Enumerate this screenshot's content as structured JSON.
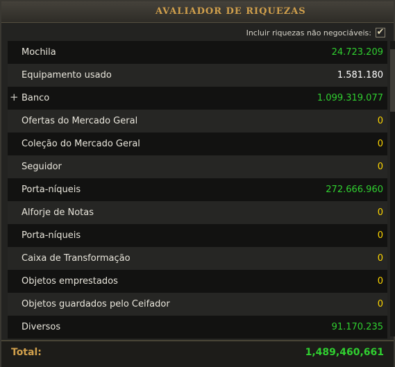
{
  "title": "AVALIADOR DE RIQUEZAS",
  "option": {
    "label": "Incluir riquezas não negociáveis:",
    "checked_glyph": "✔",
    "checked": true
  },
  "colors": {
    "value_green": "#30d030",
    "value_white": "#ffffff",
    "value_zero": "#ffd700",
    "accent": "#d1a04c"
  },
  "rows": [
    {
      "label": "Mochila",
      "value": "24.723.209",
      "tone": "green",
      "expandable": false
    },
    {
      "label": "Equipamento usado",
      "value": "1.581.180",
      "tone": "white",
      "expandable": false
    },
    {
      "label": "Banco",
      "value": "1.099.319.077",
      "tone": "green",
      "expandable": true
    },
    {
      "label": "Ofertas do Mercado Geral",
      "value": "0",
      "tone": "zero",
      "expandable": false
    },
    {
      "label": "Coleção do Mercado Geral",
      "value": "0",
      "tone": "zero",
      "expandable": false
    },
    {
      "label": "Seguidor",
      "value": "0",
      "tone": "zero",
      "expandable": false
    },
    {
      "label": "Porta-níqueis",
      "value": "272.666.960",
      "tone": "green",
      "expandable": false
    },
    {
      "label": "Alforje de Notas",
      "value": "0",
      "tone": "zero",
      "expandable": false
    },
    {
      "label": "Porta-níqueis",
      "value": "0",
      "tone": "zero",
      "expandable": false
    },
    {
      "label": "Caixa de Transformação",
      "value": "0",
      "tone": "zero",
      "expandable": false
    },
    {
      "label": "Objetos emprestados",
      "value": "0",
      "tone": "zero",
      "expandable": false
    },
    {
      "label": "Objetos guardados pelo Ceifador",
      "value": "0",
      "tone": "zero",
      "expandable": false
    },
    {
      "label": "Diversos",
      "value": "91.170.235",
      "tone": "green",
      "expandable": false
    }
  ],
  "expand_glyph": "+",
  "total": {
    "label": "Total:",
    "value": "1,489,460,661"
  }
}
